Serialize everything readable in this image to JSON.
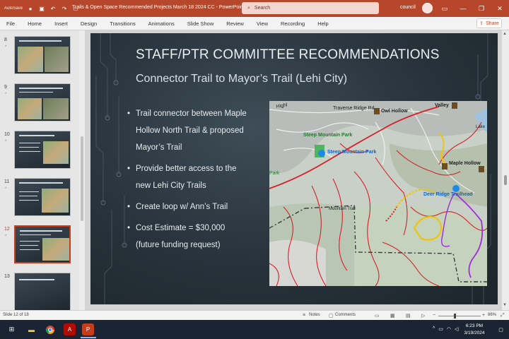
{
  "window": {
    "title": "Trails & Open Space Recommended Projects March 18 2024 CC  -  PowerPoint",
    "search_placeholder": "Search",
    "user": "council",
    "autosave": "AutoSave"
  },
  "ribbon": {
    "tabs": [
      "File",
      "Home",
      "Insert",
      "Design",
      "Transitions",
      "Animations",
      "Slide Show",
      "Review",
      "View",
      "Recording",
      "Help"
    ],
    "share_label": "Share"
  },
  "thumbnails": [
    {
      "num": "8",
      "star": "*"
    },
    {
      "num": "9",
      "star": "*"
    },
    {
      "num": "10",
      "star": "*"
    },
    {
      "num": "11",
      "star": "*"
    },
    {
      "num": "12",
      "star": "*"
    },
    {
      "num": "13",
      "star": ""
    }
  ],
  "slide": {
    "title": "STAFF/PTR COMMITTEE RECOMMENDATIONS",
    "subtitle": "Connector Trail to Mayor’s Trail (Lehi City)",
    "bullets": [
      {
        "lines": [
          "Trail connector between Maple",
          "Hollow North Trail & proposed",
          "Mayor’s Trail"
        ]
      },
      {
        "lines": [
          "Provide better access to the",
          "new Lehi City Trails"
        ]
      },
      {
        "lines": [
          "Create loop w/ Ann’s Trail"
        ]
      },
      {
        "lines": [
          "Cost Estimate = $30,000",
          "(future funding request)"
        ]
      }
    ],
    "map_labels": {
      "traverse_ridge": "Traverse Ridge Rd",
      "highland": "Highl",
      "owl_hollow": "Owl Hollow",
      "valley": "Valley",
      "steep_mountain_park_1": "Steep Mountain Park",
      "steep_mountain_park_2": "Steep Mountain Park",
      "maple_hollow": "Maple Hollow",
      "deer_ridge": "Deer Ridge Trailhead",
      "park": "Park",
      "mountain_trail": "Mountain Trail",
      "lake": "Lake"
    }
  },
  "status": {
    "slide_counter": "Slide 12 of 18",
    "notes": "Notes",
    "comments": "Comments",
    "zoom": "86%"
  },
  "taskbar": {
    "time": "6:23 PM",
    "date": "3/19/2024"
  },
  "colors": {
    "accent": "#b7472a",
    "slide_bg": "#27323a",
    "trail_red": "#d62027",
    "trail_yellow": "#f2c400",
    "trail_purple": "#a02bd6"
  }
}
